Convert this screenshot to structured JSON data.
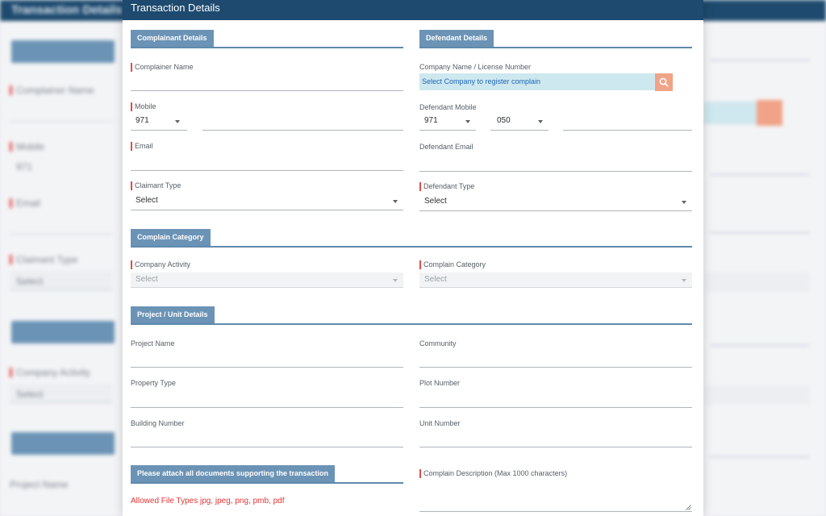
{
  "colors": {
    "header": "#1d4a6e",
    "section": "#6b93b5",
    "required": "#e34b4b",
    "search_button": "#f0a387",
    "company_input": "#cde8ef",
    "allowed_text": "#e23535"
  },
  "background": {
    "title": "Transaction Details",
    "labels": {
      "complainer": "Complainer Name",
      "mobile": "Mobile",
      "mobile_code": "971",
      "email": "Email",
      "claimant_type": "Claimant Type",
      "claimant_value": "Select",
      "company_activity": "Company Activity",
      "company_value": "Select",
      "project_name": "Project Name"
    }
  },
  "modal": {
    "title": "Transaction Details",
    "sections": {
      "complainant": "Complainant Details",
      "defendant": "Defendant Details",
      "category": "Complain Category",
      "project": "Project / Unit Details",
      "attachments": "Please attach all documents supporting the transaction"
    },
    "complainant": {
      "name_label": "Complainer Name",
      "mobile_label": "Mobile",
      "mobile_code": "971",
      "email_label": "Email",
      "type_label": "Claimant Type",
      "type_value": "Select"
    },
    "defendant": {
      "company_label": "Company Name / License Number",
      "company_placeholder": "Select Company to register complain",
      "mobile_label": "Defendant Mobile",
      "mobile_code": "971",
      "mobile_prefix": "050",
      "email_label": "Defendant Email",
      "type_label": "Defendant Type",
      "type_value": "Select"
    },
    "category": {
      "activity_label": "Company Activity",
      "activity_value": "Select",
      "category_label": "Complain Category",
      "category_value": "Select"
    },
    "project": {
      "project_name_label": "Project Name",
      "community_label": "Community",
      "property_type_label": "Property Type",
      "plot_number_label": "Plot Number",
      "building_number_label": "Building Number",
      "unit_number_label": "Unit Number"
    },
    "attachments": {
      "allowed_types": "Allowed File Types jpg, jpeg, png, pmb, pdf",
      "description_label": "Complain Description (Max 1000 characters)"
    }
  }
}
